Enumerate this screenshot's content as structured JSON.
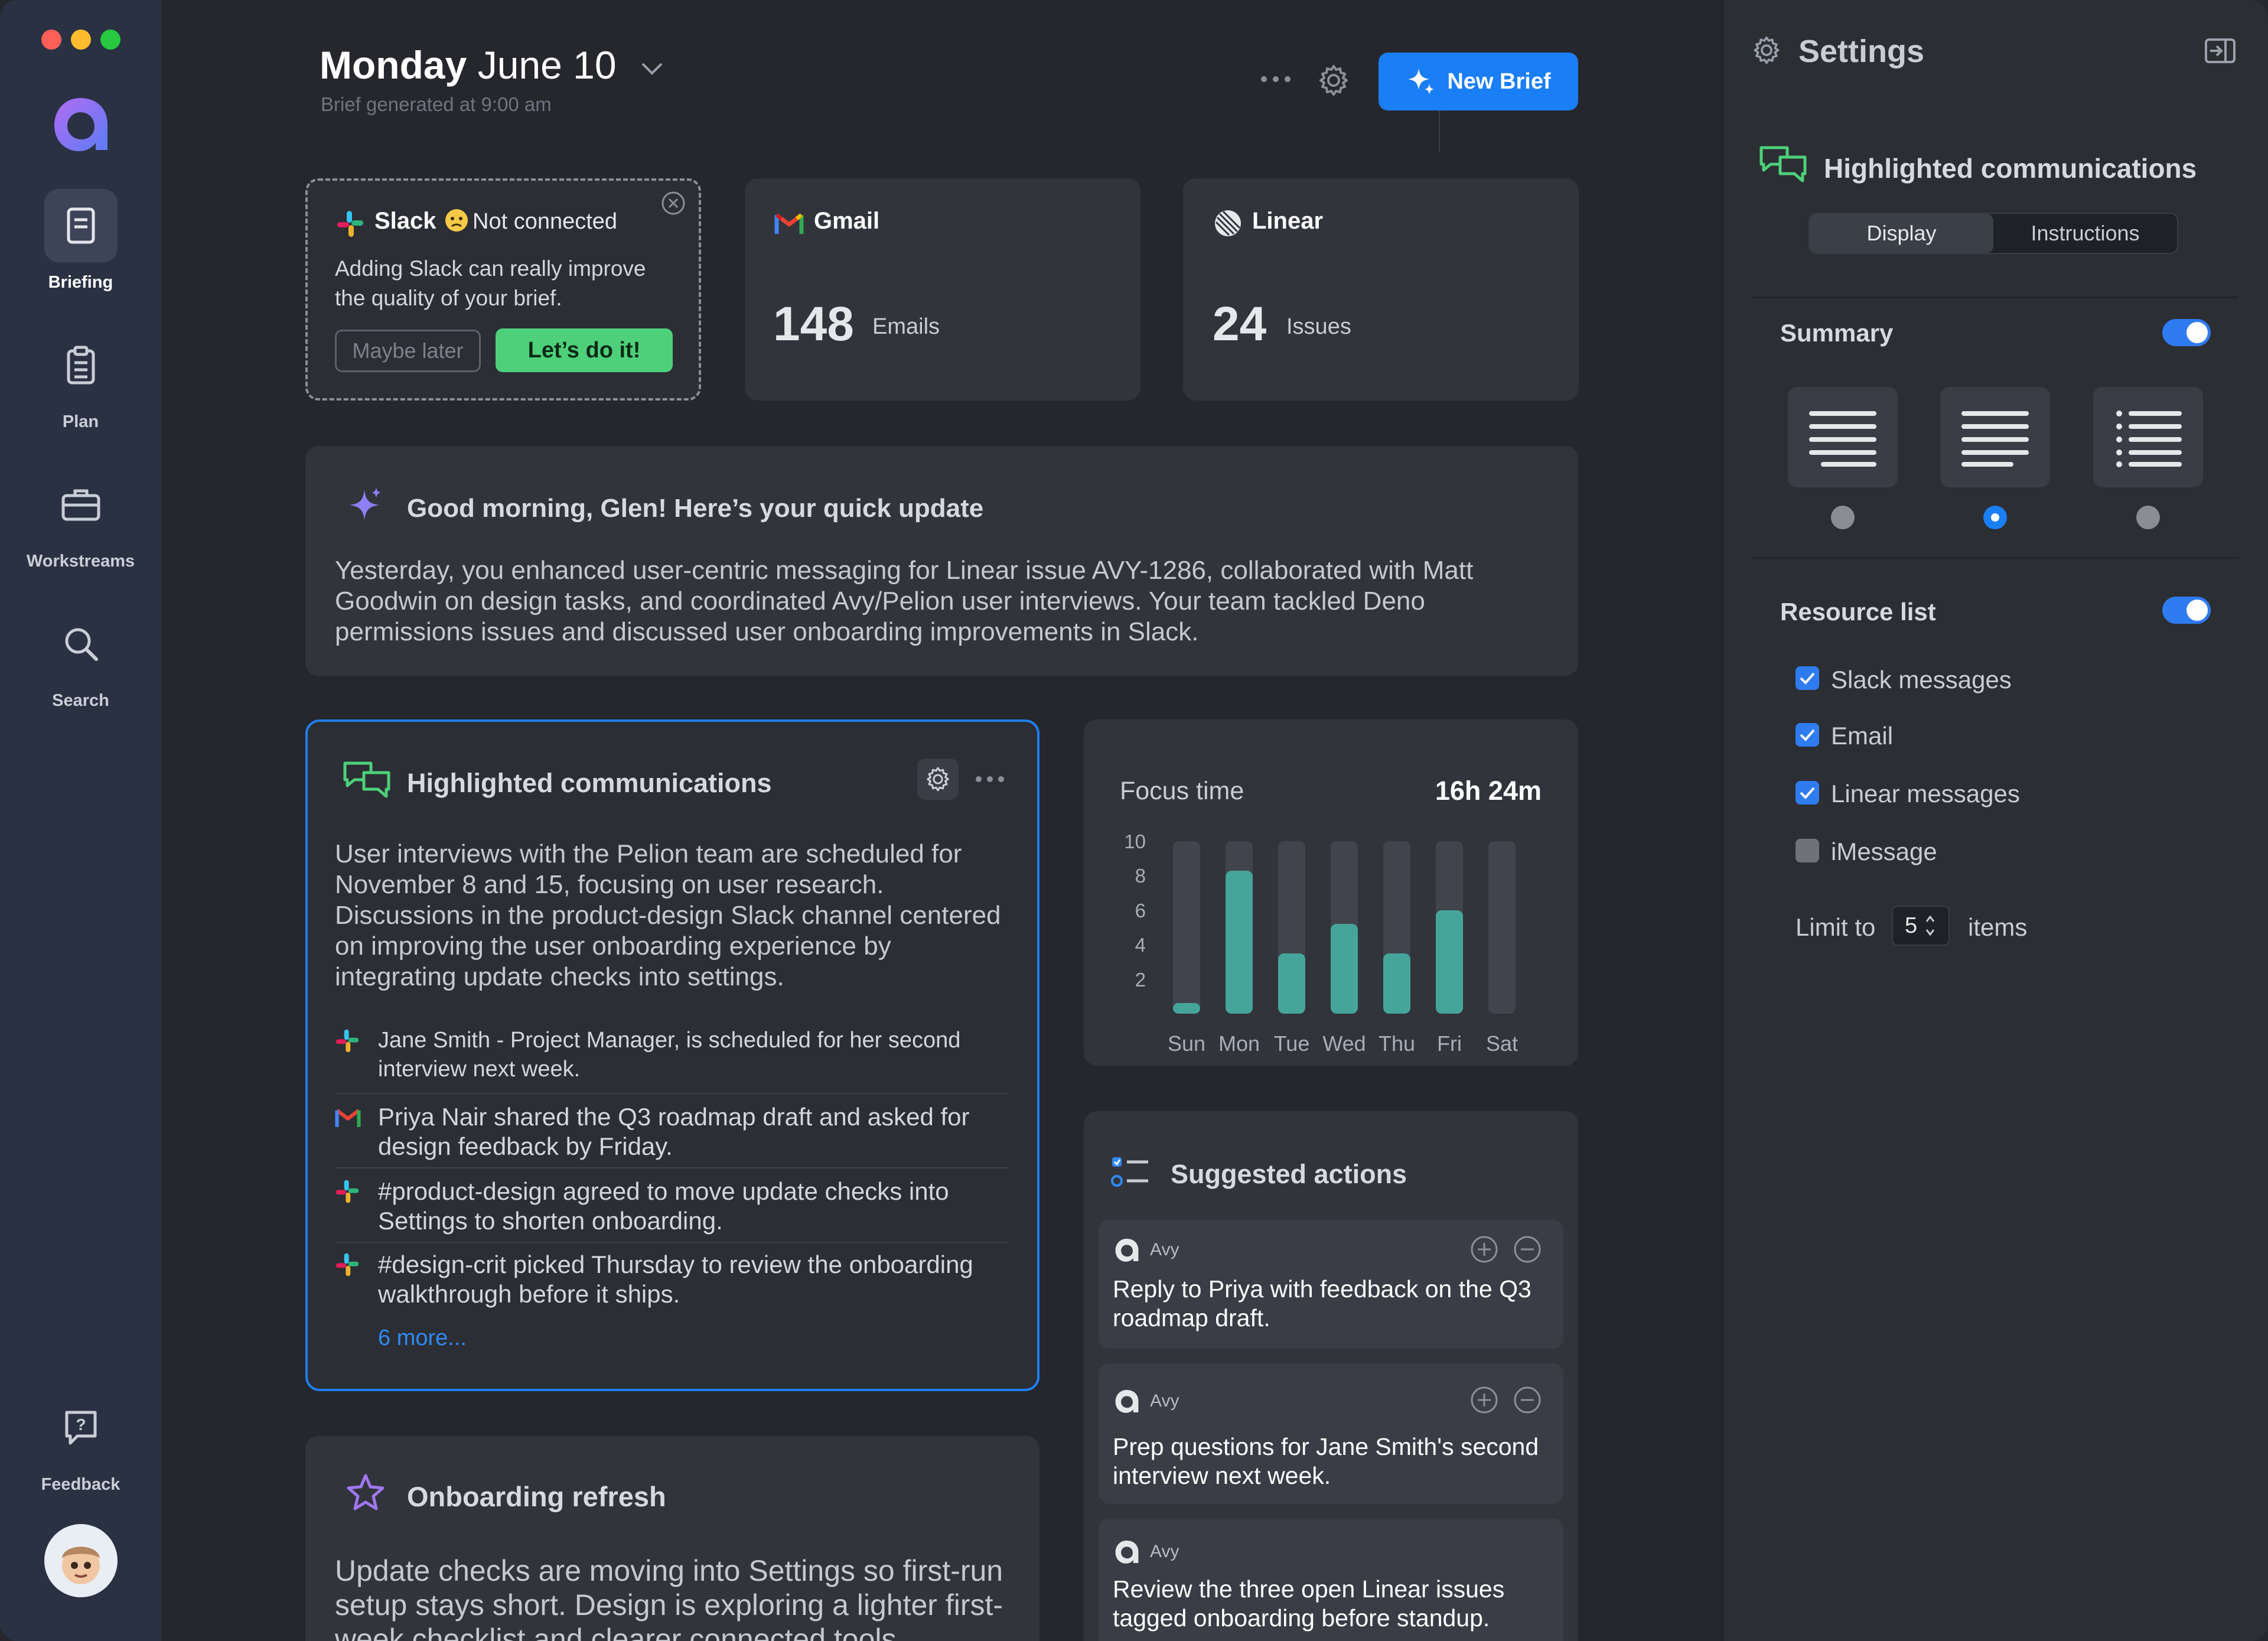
{
  "sidebar": {
    "items": [
      {
        "label": "Briefing"
      },
      {
        "label": "Plan"
      },
      {
        "label": "Workstreams"
      },
      {
        "label": "Search"
      }
    ],
    "feedback_label": "Feedback"
  },
  "header": {
    "day": "Monday",
    "date": "June 10",
    "subtitle": "Brief generated at 9:00 am",
    "new_brief_label": "New Brief"
  },
  "integrations": {
    "slack": {
      "name": "Slack",
      "status": "Not connected",
      "message": "Adding Slack can really improve the quality of your brief.",
      "later_label": "Maybe later",
      "cta_label": "Let’s do it!"
    },
    "gmail": {
      "name": "Gmail",
      "count": "148",
      "unit": "Emails"
    },
    "linear": {
      "name": "Linear",
      "count": "24",
      "unit": "Issues"
    }
  },
  "update": {
    "title": "Good morning, Glen! Here’s your quick update",
    "body": "Yesterday, you enhanced user-centric messaging for Linear issue AVY-1286, collaborated with Matt Goodwin on design tasks, and coordinated Avy/Pelion user interviews. Your team tackled Deno permissions issues and discussed user onboarding improvements in Slack."
  },
  "highlighted": {
    "title": "Highlighted communications",
    "summary": "User interviews with the Pelion team are scheduled for November 8 and 15, focusing on user research. Discussions in the product-design Slack channel centered on improving the user onboarding experience by integrating update checks into settings.",
    "items": [
      {
        "source": "slack",
        "text": "Jane Smith - Project Manager, is scheduled for her second interview next week."
      },
      {
        "source": "gmail",
        "text": "Priya Nair shared the Q3 roadmap draft and asked for design feedback by Friday."
      },
      {
        "source": "slack",
        "text": "#product-design agreed to move update checks into Settings to shorten onboarding."
      },
      {
        "source": "slack",
        "text": "#design-crit picked Thursday to review the onboarding walkthrough before it ships."
      }
    ],
    "more_label": "6 more..."
  },
  "focus": {
    "title": "Focus time",
    "total": "16h 24m"
  },
  "chart_data": {
    "type": "bar",
    "categories": [
      "Sun",
      "Mon",
      "Tue",
      "Wed",
      "Thu",
      "Fri",
      "Sat"
    ],
    "values": [
      0.6,
      8.3,
      3.5,
      5.2,
      3.5,
      6.0,
      0
    ],
    "yticks": [
      "10",
      "8",
      "6",
      "4",
      "2"
    ],
    "ylim": [
      0,
      10
    ],
    "colors": {
      "fill": "#46a59a",
      "track": "#41444c"
    }
  },
  "suggested": {
    "title": "Suggested actions",
    "items": [
      {
        "agent": "Avy",
        "text": "Reply to Priya with feedback on the Q3 roadmap draft."
      },
      {
        "agent": "Avy",
        "text": "Prep questions for Jane Smith's second interview next week."
      },
      {
        "agent": "Avy",
        "text": "Review the three open Linear issues tagged onboarding before standup."
      }
    ]
  },
  "onboarding": {
    "title": "Onboarding refresh",
    "body": "Update checks are moving into Settings so first-run setup stays short. Design is exploring a lighter first-week checklist and clearer connected tools."
  },
  "settings": {
    "title": "Settings",
    "section_title": "Highlighted communications",
    "tabs": [
      "Display",
      "Instructions"
    ],
    "summary_label": "Summary",
    "resource_label": "Resource list",
    "resources": [
      {
        "label": "Slack messages",
        "checked": true
      },
      {
        "label": "Email",
        "checked": true
      },
      {
        "label": "Linear messages",
        "checked": true
      },
      {
        "label": "iMessage",
        "checked": false
      }
    ],
    "limit_prefix": "Limit to",
    "limit_value": "5",
    "limit_suffix": "items"
  },
  "colors": {
    "accent": "#1a7ef6",
    "success": "#4ed07a",
    "chart": "#46a59a"
  }
}
